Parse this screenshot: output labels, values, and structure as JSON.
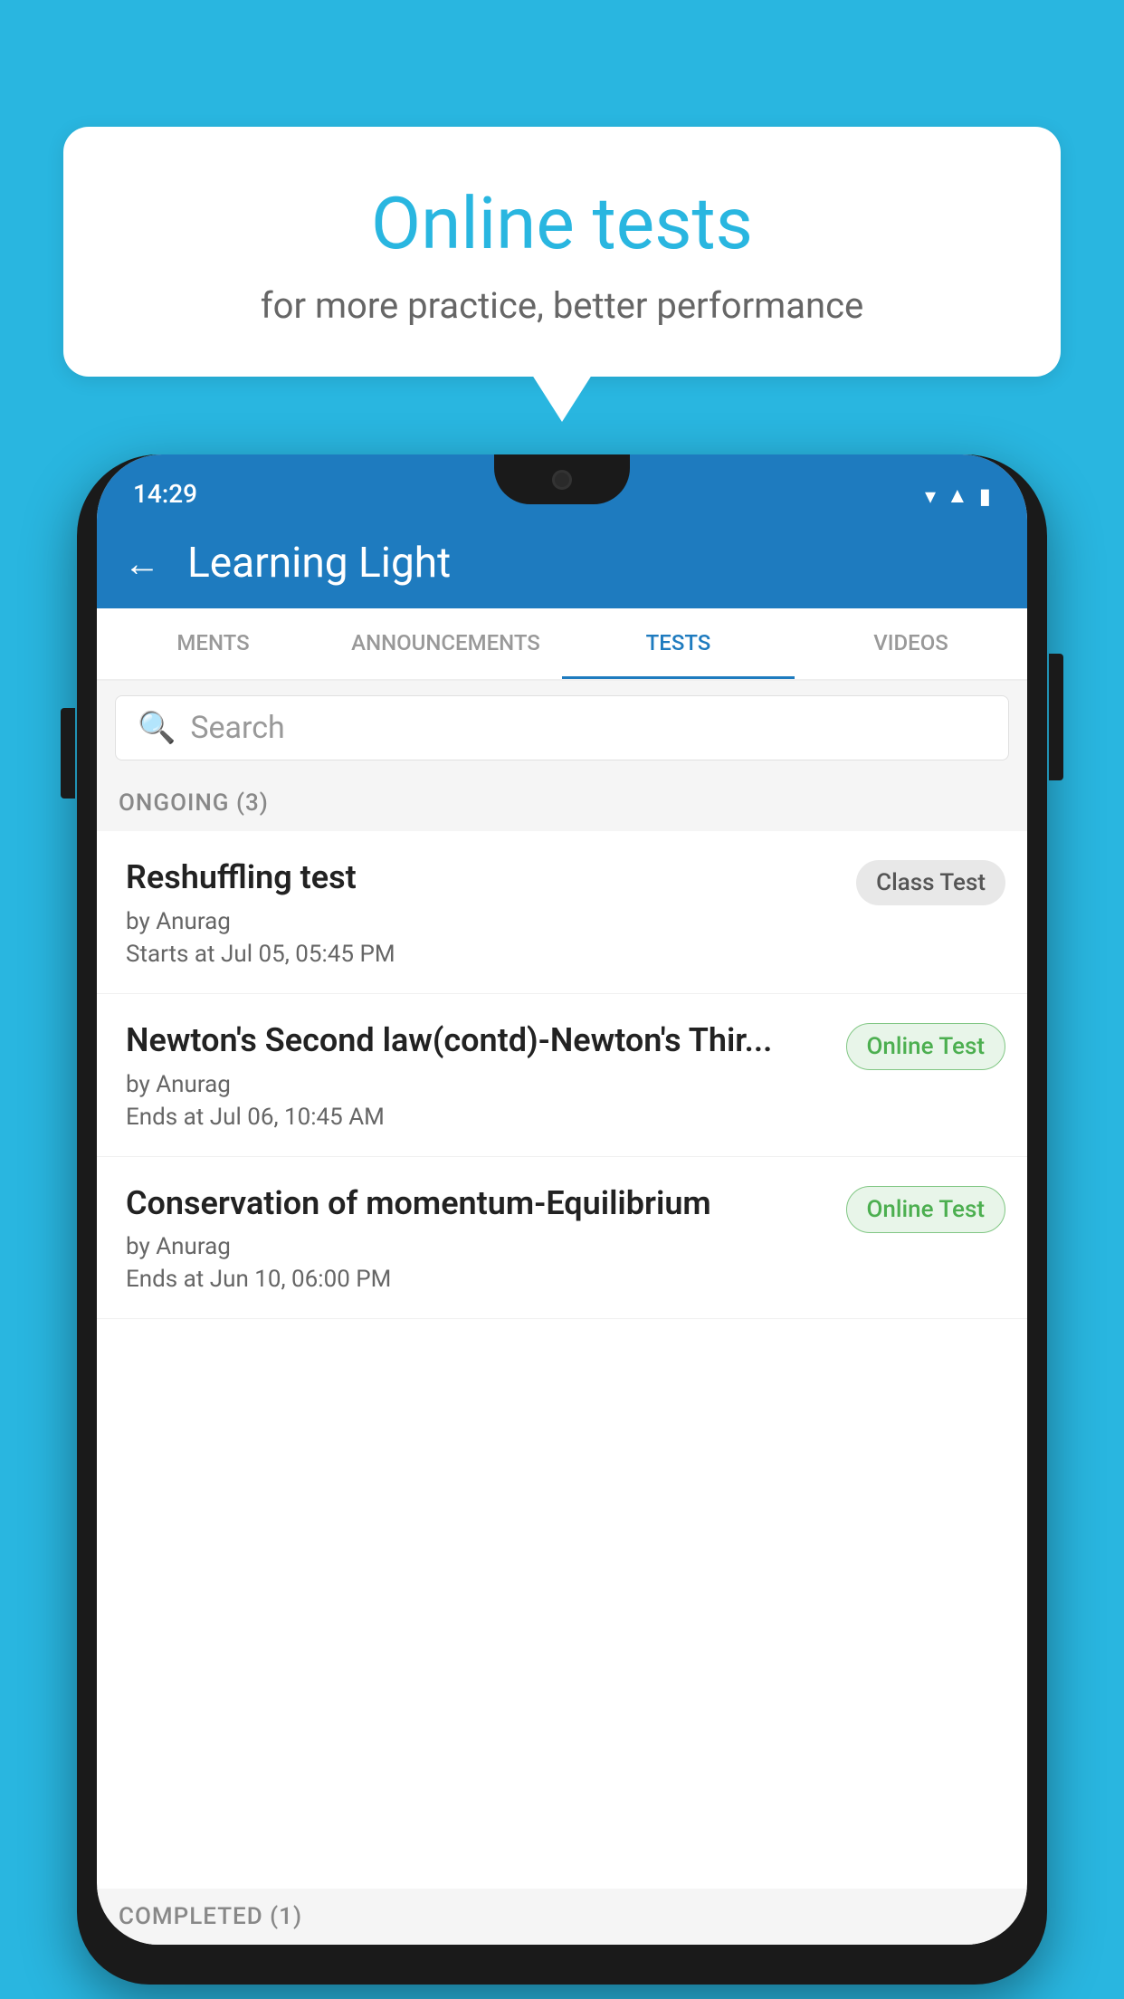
{
  "background_color": "#29b6e0",
  "bubble": {
    "title": "Online tests",
    "subtitle": "for more practice, better performance"
  },
  "phone": {
    "status_bar": {
      "time": "14:29",
      "icons": [
        "wifi",
        "signal",
        "battery"
      ]
    },
    "app_bar": {
      "title": "Learning Light",
      "back_label": "←"
    },
    "tabs": [
      {
        "label": "MENTS",
        "active": false
      },
      {
        "label": "ANNOUNCEMENTS",
        "active": false
      },
      {
        "label": "TESTS",
        "active": true
      },
      {
        "label": "VIDEOS",
        "active": false
      }
    ],
    "search": {
      "placeholder": "Search"
    },
    "ongoing_section": {
      "label": "ONGOING (3)"
    },
    "tests": [
      {
        "title": "Reshuffling test",
        "author": "by Anurag",
        "time_label": "Starts at",
        "time": "Jul 05, 05:45 PM",
        "badge": "Class Test",
        "badge_type": "class"
      },
      {
        "title": "Newton's Second law(contd)-Newton's Thir...",
        "author": "by Anurag",
        "time_label": "Ends at",
        "time": "Jul 06, 10:45 AM",
        "badge": "Online Test",
        "badge_type": "online"
      },
      {
        "title": "Conservation of momentum-Equilibrium",
        "author": "by Anurag",
        "time_label": "Ends at",
        "time": "Jun 10, 06:00 PM",
        "badge": "Online Test",
        "badge_type": "online"
      }
    ],
    "completed_section": {
      "label": "COMPLETED (1)"
    }
  }
}
